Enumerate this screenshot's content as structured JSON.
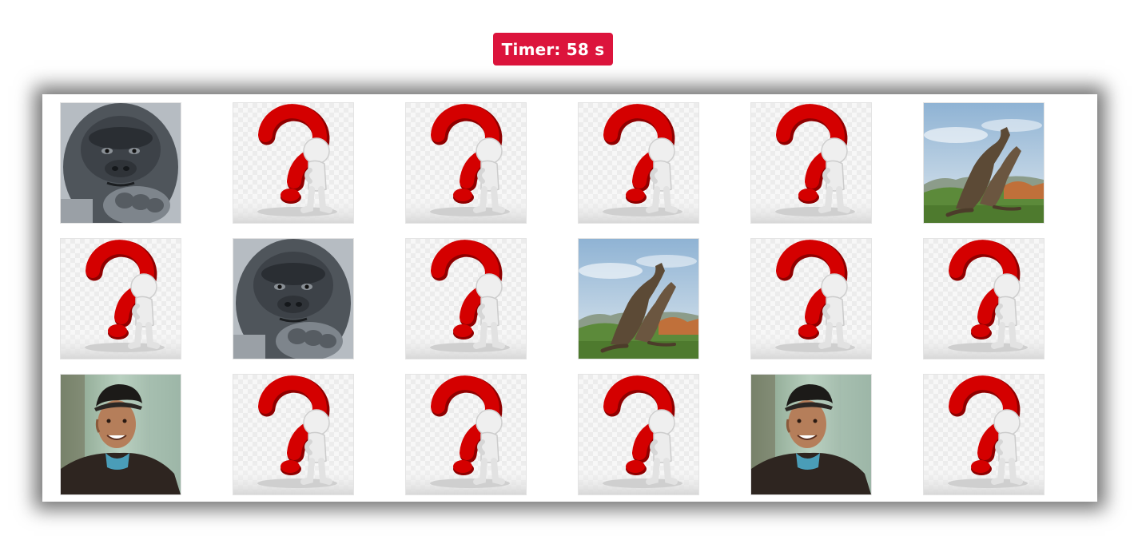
{
  "timer": {
    "label": "Timer: 58 s",
    "seconds_remaining": 58,
    "color": "#dc143c"
  },
  "board": {
    "rows": 3,
    "columns": 6,
    "cards": [
      {
        "state": "revealed",
        "image": "gorilla"
      },
      {
        "state": "hidden",
        "image": "question-mark"
      },
      {
        "state": "hidden",
        "image": "question-mark"
      },
      {
        "state": "hidden",
        "image": "question-mark"
      },
      {
        "state": "hidden",
        "image": "question-mark"
      },
      {
        "state": "revealed",
        "image": "komodo-dragons"
      },
      {
        "state": "hidden",
        "image": "question-mark"
      },
      {
        "state": "revealed",
        "image": "gorilla"
      },
      {
        "state": "hidden",
        "image": "question-mark"
      },
      {
        "state": "revealed",
        "image": "komodo-dragons"
      },
      {
        "state": "hidden",
        "image": "question-mark"
      },
      {
        "state": "hidden",
        "image": "question-mark"
      },
      {
        "state": "revealed",
        "image": "smiling-man"
      },
      {
        "state": "hidden",
        "image": "question-mark"
      },
      {
        "state": "hidden",
        "image": "question-mark"
      },
      {
        "state": "hidden",
        "image": "question-mark"
      },
      {
        "state": "revealed",
        "image": "smiling-man"
      },
      {
        "state": "hidden",
        "image": "question-mark"
      }
    ]
  },
  "colors": {
    "question_mark_red": "#d40000",
    "board_background": "#ffffff"
  }
}
